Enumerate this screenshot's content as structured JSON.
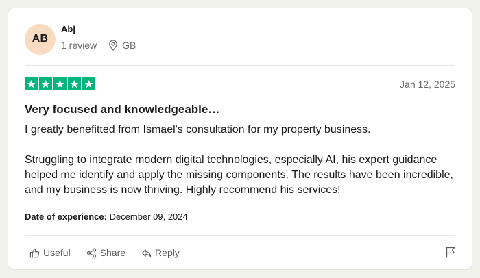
{
  "reviewer": {
    "initials": "AB",
    "name": "Abj",
    "review_count": "1 review",
    "country": "GB",
    "avatar_color": "#f9dcc0"
  },
  "review": {
    "rating": 5,
    "max_rating": 5,
    "star_color": "#00b67a",
    "date": "Jan 12, 2025",
    "title": "Very focused and knowledgeable…",
    "paragraphs": [
      "I greatly benefitted from Ismael's consultation for my property business.",
      "Struggling to integrate modern digital technologies, especially AI, his expert guidance helped me identify and apply the missing components. The results have been incredible, and my business is now thriving. Highly recommend his services!"
    ],
    "experience_label": "Date of experience:",
    "experience_date": "December 09, 2024"
  },
  "actions": {
    "useful_label": "Useful",
    "share_label": "Share",
    "reply_label": "Reply",
    "useful_icon": "thumbs-up-icon",
    "share_icon": "share-icon",
    "reply_icon": "reply-icon",
    "report_icon": "flag-icon"
  }
}
